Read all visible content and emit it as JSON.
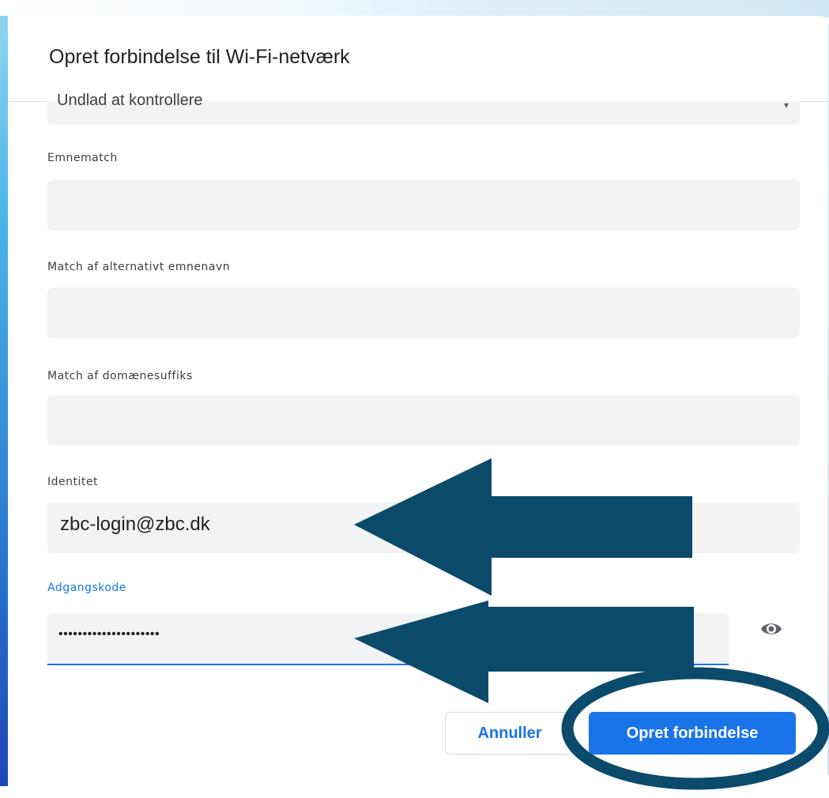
{
  "dialog": {
    "title": "Opret forbindelse til Wi-Fi-netværk",
    "cut_field_value": "Undlad at kontrollere"
  },
  "fields": {
    "subject_match": {
      "label": "Emnematch",
      "value": ""
    },
    "alt_subject_match": {
      "label": "Match af alternativt emnenavn",
      "value": ""
    },
    "domain_suffix": {
      "label": "Match af domænesuffiks",
      "value": ""
    },
    "identity": {
      "label": "Identitet",
      "value": "zbc-login@zbc.dk"
    },
    "password": {
      "label": "Adgangskode",
      "value": "•••••••••••••••••••••"
    }
  },
  "buttons": {
    "cancel": "Annuller",
    "connect": "Opret forbindelse"
  },
  "icons": {
    "show_password": "eye-icon",
    "select_arrow": "chevron-down-icon"
  },
  "colors": {
    "accent": "#1a73e8",
    "annotation": "#0b4a6b",
    "field_bg": "#f1f3f4"
  }
}
